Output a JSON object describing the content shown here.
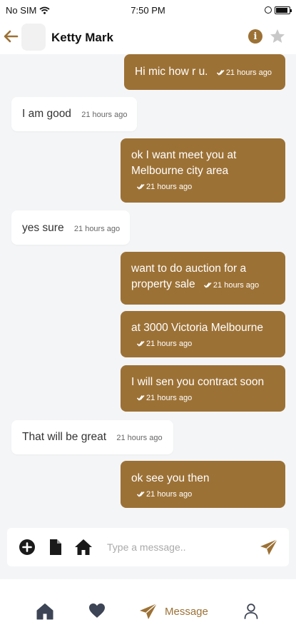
{
  "status_bar": {
    "carrier": "No SIM",
    "time": "7:50 PM"
  },
  "header": {
    "contact_name": "Ketty Mark",
    "info_label": "i"
  },
  "messages": [
    {
      "direction": "out",
      "lines": [
        "Hi mic how r u."
      ],
      "time": "21 hours ago"
    },
    {
      "direction": "in",
      "lines": [
        "I am good"
      ],
      "time": "21 hours ago"
    },
    {
      "direction": "out",
      "lines": [
        "ok I want meet you at",
        "Melbourne city area"
      ],
      "time": "21 hours ago"
    },
    {
      "direction": "in",
      "lines": [
        "yes sure"
      ],
      "time": "21 hours ago"
    },
    {
      "direction": "out",
      "lines": [
        "want to do auction for a",
        "property sale"
      ],
      "time": "21 hours ago"
    },
    {
      "direction": "out",
      "lines": [
        "at 3000 Victoria Melbourne"
      ],
      "time": "21 hours ago"
    },
    {
      "direction": "out",
      "lines": [
        "I will sen you contract soon"
      ],
      "time": "21 hours ago"
    },
    {
      "direction": "in",
      "lines": [
        "That will be great"
      ],
      "time": "21 hours ago"
    },
    {
      "direction": "out",
      "lines": [
        "ok see you then"
      ],
      "time": "21 hours ago"
    }
  ],
  "composer": {
    "placeholder": "Type a message..",
    "value": ""
  },
  "bottom_nav": {
    "items": [
      {
        "icon": "home-icon"
      },
      {
        "icon": "heart-icon"
      },
      {
        "icon": "send-icon",
        "label": "Message",
        "active": true
      },
      {
        "icon": "person-icon"
      }
    ]
  },
  "colors": {
    "accent": "#9c7135",
    "background": "#f4f5f7",
    "incoming_bubble": "#ffffff"
  }
}
